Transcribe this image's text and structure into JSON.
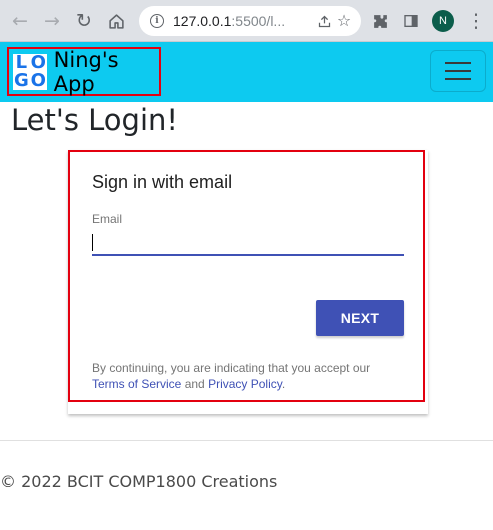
{
  "browser": {
    "url_host": "127.0.0.1",
    "url_rest": ":5500/l...",
    "profile_initial": "N",
    "icons": [
      "back-arrow-icon",
      "forward-arrow-icon",
      "reload-icon",
      "home-icon",
      "info-icon",
      "share-icon",
      "star-icon",
      "extensions-icon",
      "side-panel-icon",
      "more-vert-icon"
    ]
  },
  "navbar": {
    "logo_letters": [
      "L",
      "O",
      "G",
      "O"
    ],
    "brand_name": "Ning's App",
    "background_color": "#0dcaf0"
  },
  "main": {
    "page_title": "Let's Login!"
  },
  "signin": {
    "title": "Sign in with email",
    "email_label": "Email",
    "email_value": "",
    "next_label": "NEXT",
    "tos_prefix": "By continuing, you are indicating that you accept our",
    "tos_link": "Terms of Service",
    "tos_and": "and",
    "privacy_link": "Privacy Policy",
    "tos_suffix": ".",
    "accent_color": "#3f51b5"
  },
  "footer": {
    "text": "© 2022 BCIT COMP1800 Creations"
  }
}
